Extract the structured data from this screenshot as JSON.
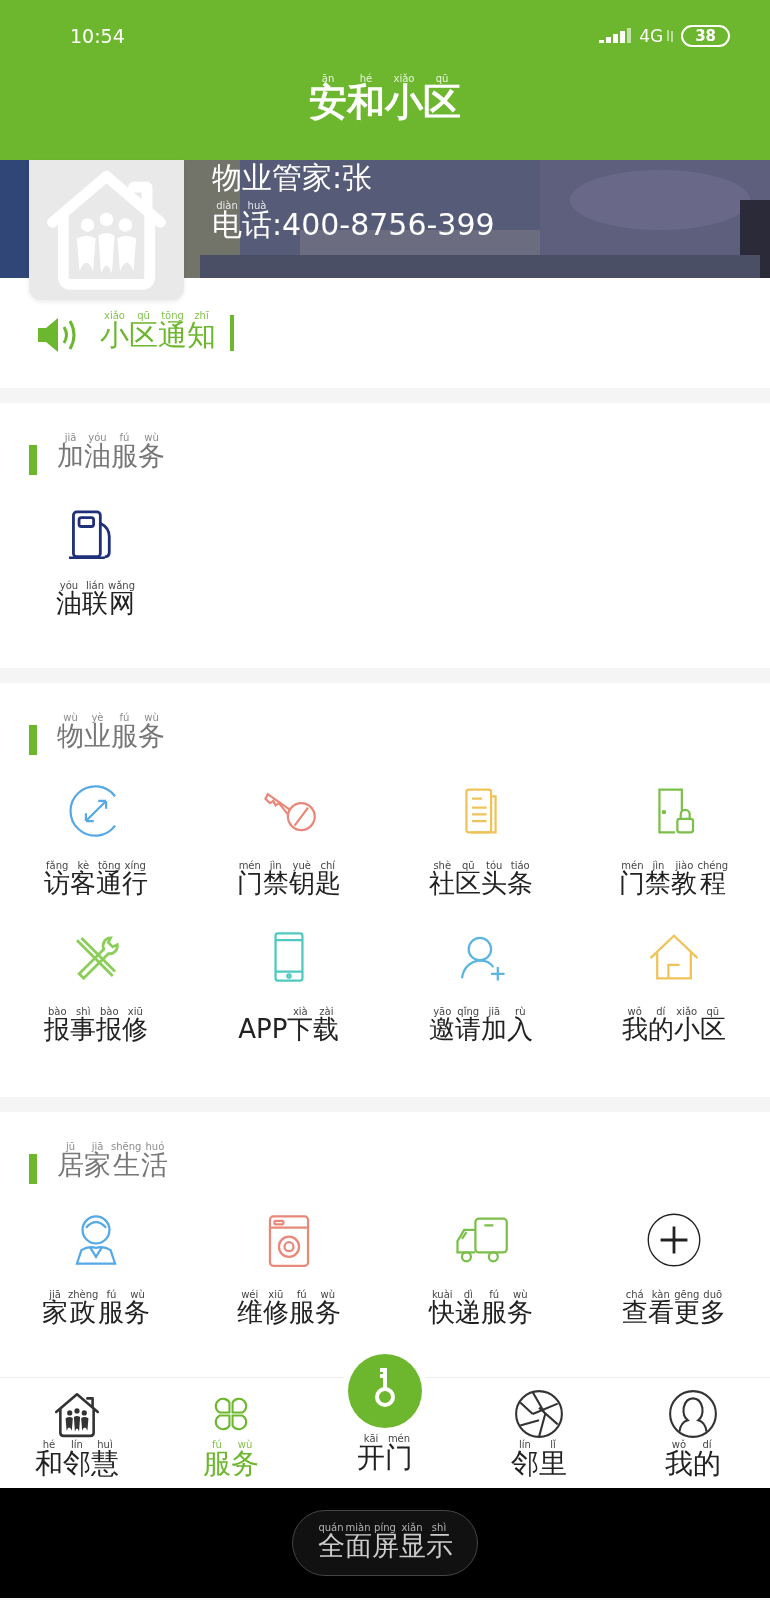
{
  "status_bar": {
    "time": "10:54",
    "network": "4G",
    "battery": "38"
  },
  "header": {
    "title": [
      {
        "t": "安",
        "py": "ān"
      },
      {
        "t": "和",
        "py": "hé"
      },
      {
        "t": "小",
        "py": "xiǎo"
      },
      {
        "t": "区",
        "py": "qū"
      }
    ]
  },
  "manager": {
    "name": [
      {
        "t": "物业管家:张"
      }
    ],
    "phone": [
      {
        "t": "电",
        "py": "diàn"
      },
      {
        "t": "话",
        "py": "huà"
      },
      {
        "t": ":400-8756-399"
      }
    ]
  },
  "notice": {
    "label": [
      {
        "t": "小",
        "py": "xiǎo"
      },
      {
        "t": "区",
        "py": "qū"
      },
      {
        "t": "通",
        "py": "tōng"
      },
      {
        "t": "知",
        "py": "zhī"
      }
    ]
  },
  "sections": [
    {
      "title": [
        {
          "t": "加",
          "py": "jiā"
        },
        {
          "t": "油",
          "py": "yóu"
        },
        {
          "t": "服",
          "py": "fú"
        },
        {
          "t": "务",
          "py": "wù"
        }
      ],
      "items": [
        {
          "label": [
            {
              "t": "油",
              "py": "yóu"
            },
            {
              "t": "联",
              "py": "lián"
            },
            {
              "t": "网",
              "py": "wǎng"
            }
          ]
        }
      ]
    },
    {
      "title": [
        {
          "t": "物",
          "py": "wù"
        },
        {
          "t": "业",
          "py": "yè"
        },
        {
          "t": "服",
          "py": "fú"
        },
        {
          "t": "务",
          "py": "wù"
        }
      ],
      "items": [
        {
          "label": [
            {
              "t": "访",
              "py": "fǎng"
            },
            {
              "t": "客",
              "py": "kè"
            },
            {
              "t": "通",
              "py": "tōng"
            },
            {
              "t": "行",
              "py": "xíng"
            }
          ]
        },
        {
          "label": [
            {
              "t": "门",
              "py": "mén"
            },
            {
              "t": "禁",
              "py": "jìn"
            },
            {
              "t": "钥",
              "py": "yuè"
            },
            {
              "t": "匙",
              "py": "chí"
            }
          ]
        },
        {
          "label": [
            {
              "t": "社",
              "py": "shè"
            },
            {
              "t": "区",
              "py": "qū"
            },
            {
              "t": "头",
              "py": "tóu"
            },
            {
              "t": "条",
              "py": "tiáo"
            }
          ]
        },
        {
          "label": [
            {
              "t": "门",
              "py": "mén"
            },
            {
              "t": "禁",
              "py": "jìn"
            },
            {
              "t": "教",
              "py": "jiào"
            },
            {
              "t": "程",
              "py": "chéng"
            }
          ]
        },
        {
          "label": [
            {
              "t": "报",
              "py": "bào"
            },
            {
              "t": "事",
              "py": "shì"
            },
            {
              "t": "报",
              "py": "bào"
            },
            {
              "t": "修",
              "py": "xiū"
            }
          ]
        },
        {
          "label": [
            {
              "t": "APP"
            },
            {
              "t": "下",
              "py": "xià"
            },
            {
              "t": "载",
              "py": "zài"
            }
          ]
        },
        {
          "label": [
            {
              "t": "邀",
              "py": "yāo"
            },
            {
              "t": "请",
              "py": "qǐng"
            },
            {
              "t": "加",
              "py": "jiā"
            },
            {
              "t": "入",
              "py": "rù"
            }
          ]
        },
        {
          "label": [
            {
              "t": "我",
              "py": "wǒ"
            },
            {
              "t": "的",
              "py": "dí"
            },
            {
              "t": "小",
              "py": "xiǎo"
            },
            {
              "t": "区",
              "py": "qū"
            }
          ]
        }
      ]
    },
    {
      "title": [
        {
          "t": "居",
          "py": "jū"
        },
        {
          "t": "家",
          "py": "jiā"
        },
        {
          "t": "生",
          "py": "shēng"
        },
        {
          "t": "活",
          "py": "huó"
        }
      ],
      "items": [
        {
          "label": [
            {
              "t": "家",
              "py": "jiā"
            },
            {
              "t": "政",
              "py": "zhèng"
            },
            {
              "t": "服",
              "py": "fú"
            },
            {
              "t": "务",
              "py": "wù"
            }
          ]
        },
        {
          "label": [
            {
              "t": "维",
              "py": "wéi"
            },
            {
              "t": "修",
              "py": "xiū"
            },
            {
              "t": "服",
              "py": "fú"
            },
            {
              "t": "务",
              "py": "wù"
            }
          ]
        },
        {
          "label": [
            {
              "t": "快",
              "py": "kuài"
            },
            {
              "t": "递",
              "py": "dì"
            },
            {
              "t": "服",
              "py": "fú"
            },
            {
              "t": "务",
              "py": "wù"
            }
          ]
        },
        {
          "label": [
            {
              "t": "查",
              "py": "chá"
            },
            {
              "t": "看",
              "py": "kàn"
            },
            {
              "t": "更",
              "py": "gēng"
            },
            {
              "t": "多",
              "py": "duō"
            }
          ]
        }
      ]
    }
  ],
  "bottom_nav": [
    {
      "kind": "tab",
      "selected": false,
      "label": [
        {
          "t": "和",
          "py": "hé"
        },
        {
          "t": "邻",
          "py": "lín"
        },
        {
          "t": "慧",
          "py": "huì"
        }
      ]
    },
    {
      "kind": "tab",
      "selected": true,
      "label": [
        {
          "t": "服",
          "py": "fú"
        },
        {
          "t": "务",
          "py": "wù"
        }
      ]
    },
    {
      "kind": "center",
      "selected": false,
      "label": [
        {
          "t": "开",
          "py": "kāi"
        },
        {
          "t": "门",
          "py": "mén"
        }
      ]
    },
    {
      "kind": "tab",
      "selected": false,
      "label": [
        {
          "t": "邻",
          "py": "lín"
        },
        {
          "t": "里",
          "py": "lǐ"
        }
      ]
    },
    {
      "kind": "tab",
      "selected": false,
      "label": [
        {
          "t": "我",
          "py": "wǒ"
        },
        {
          "t": "的",
          "py": "dí"
        }
      ]
    }
  ],
  "fullscreen_button": {
    "label": [
      {
        "t": "全",
        "py": "quán"
      },
      {
        "t": "面",
        "py": "miàn"
      },
      {
        "t": "屏",
        "py": "píng"
      },
      {
        "t": "显",
        "py": "xiǎn"
      },
      {
        "t": "示",
        "py": "shì"
      }
    ]
  }
}
